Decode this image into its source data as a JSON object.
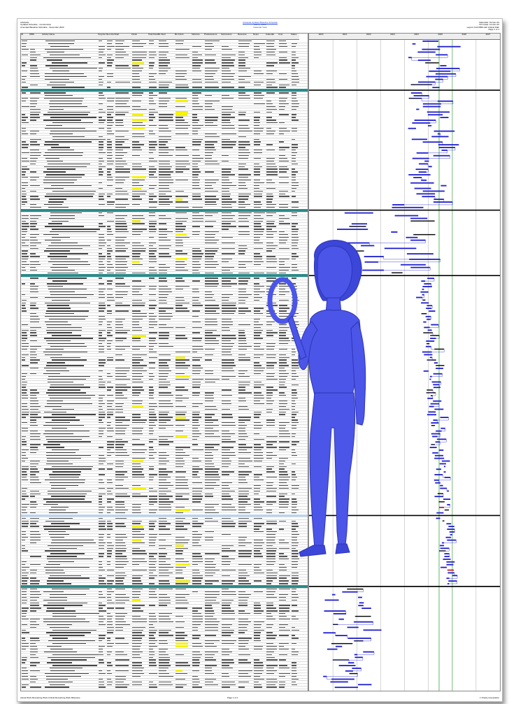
{
  "header": {
    "left_lines": [
      "Arboleda",
      "Updated Schedule - Construction",
      "Amended Baseline Schedule - November 2023"
    ],
    "center_lines": [
      "Arboleda Updated Baseline Schedule",
      "Rev 3 - 2023",
      "Calendar View"
    ],
    "right_lines": [
      "Data date: 01-Nov-23",
      "Print date: 14-Nov-23",
      "Layout: Full WBS with Critical Path",
      "Page 1 of 1"
    ]
  },
  "columns": [
    "ID",
    "WBS",
    "Activity Name",
    "Orig Dur",
    "Rem Dur",
    "Start",
    "Finish",
    "Total Float",
    "BL Start",
    "BL Finish",
    "Variance",
    "Predecessors",
    "Successors",
    "Resource",
    "Notes",
    "Calendar",
    "Cost",
    "Status"
  ],
  "timeline_years": [
    "2020",
    "2021",
    "2022",
    "2023",
    "2024",
    "2025",
    "2026",
    "2027"
  ],
  "footer": {
    "left": "Actual Work    Remaining Work    Critical Remaining Work    Milestone",
    "center": "Page 1 of 1",
    "right": "© Oracle Corporation"
  },
  "colors": {
    "bar": "#1f1fd0",
    "critical": "#d01f1f",
    "summary": "#000000",
    "band_teal": "#2a8a8a",
    "band_blue": "#b8d4f0",
    "highlight": "#f5f200",
    "figure": "#4b55e8"
  },
  "figure": {
    "icon": "person-with-magnifying-glass-icon"
  }
}
